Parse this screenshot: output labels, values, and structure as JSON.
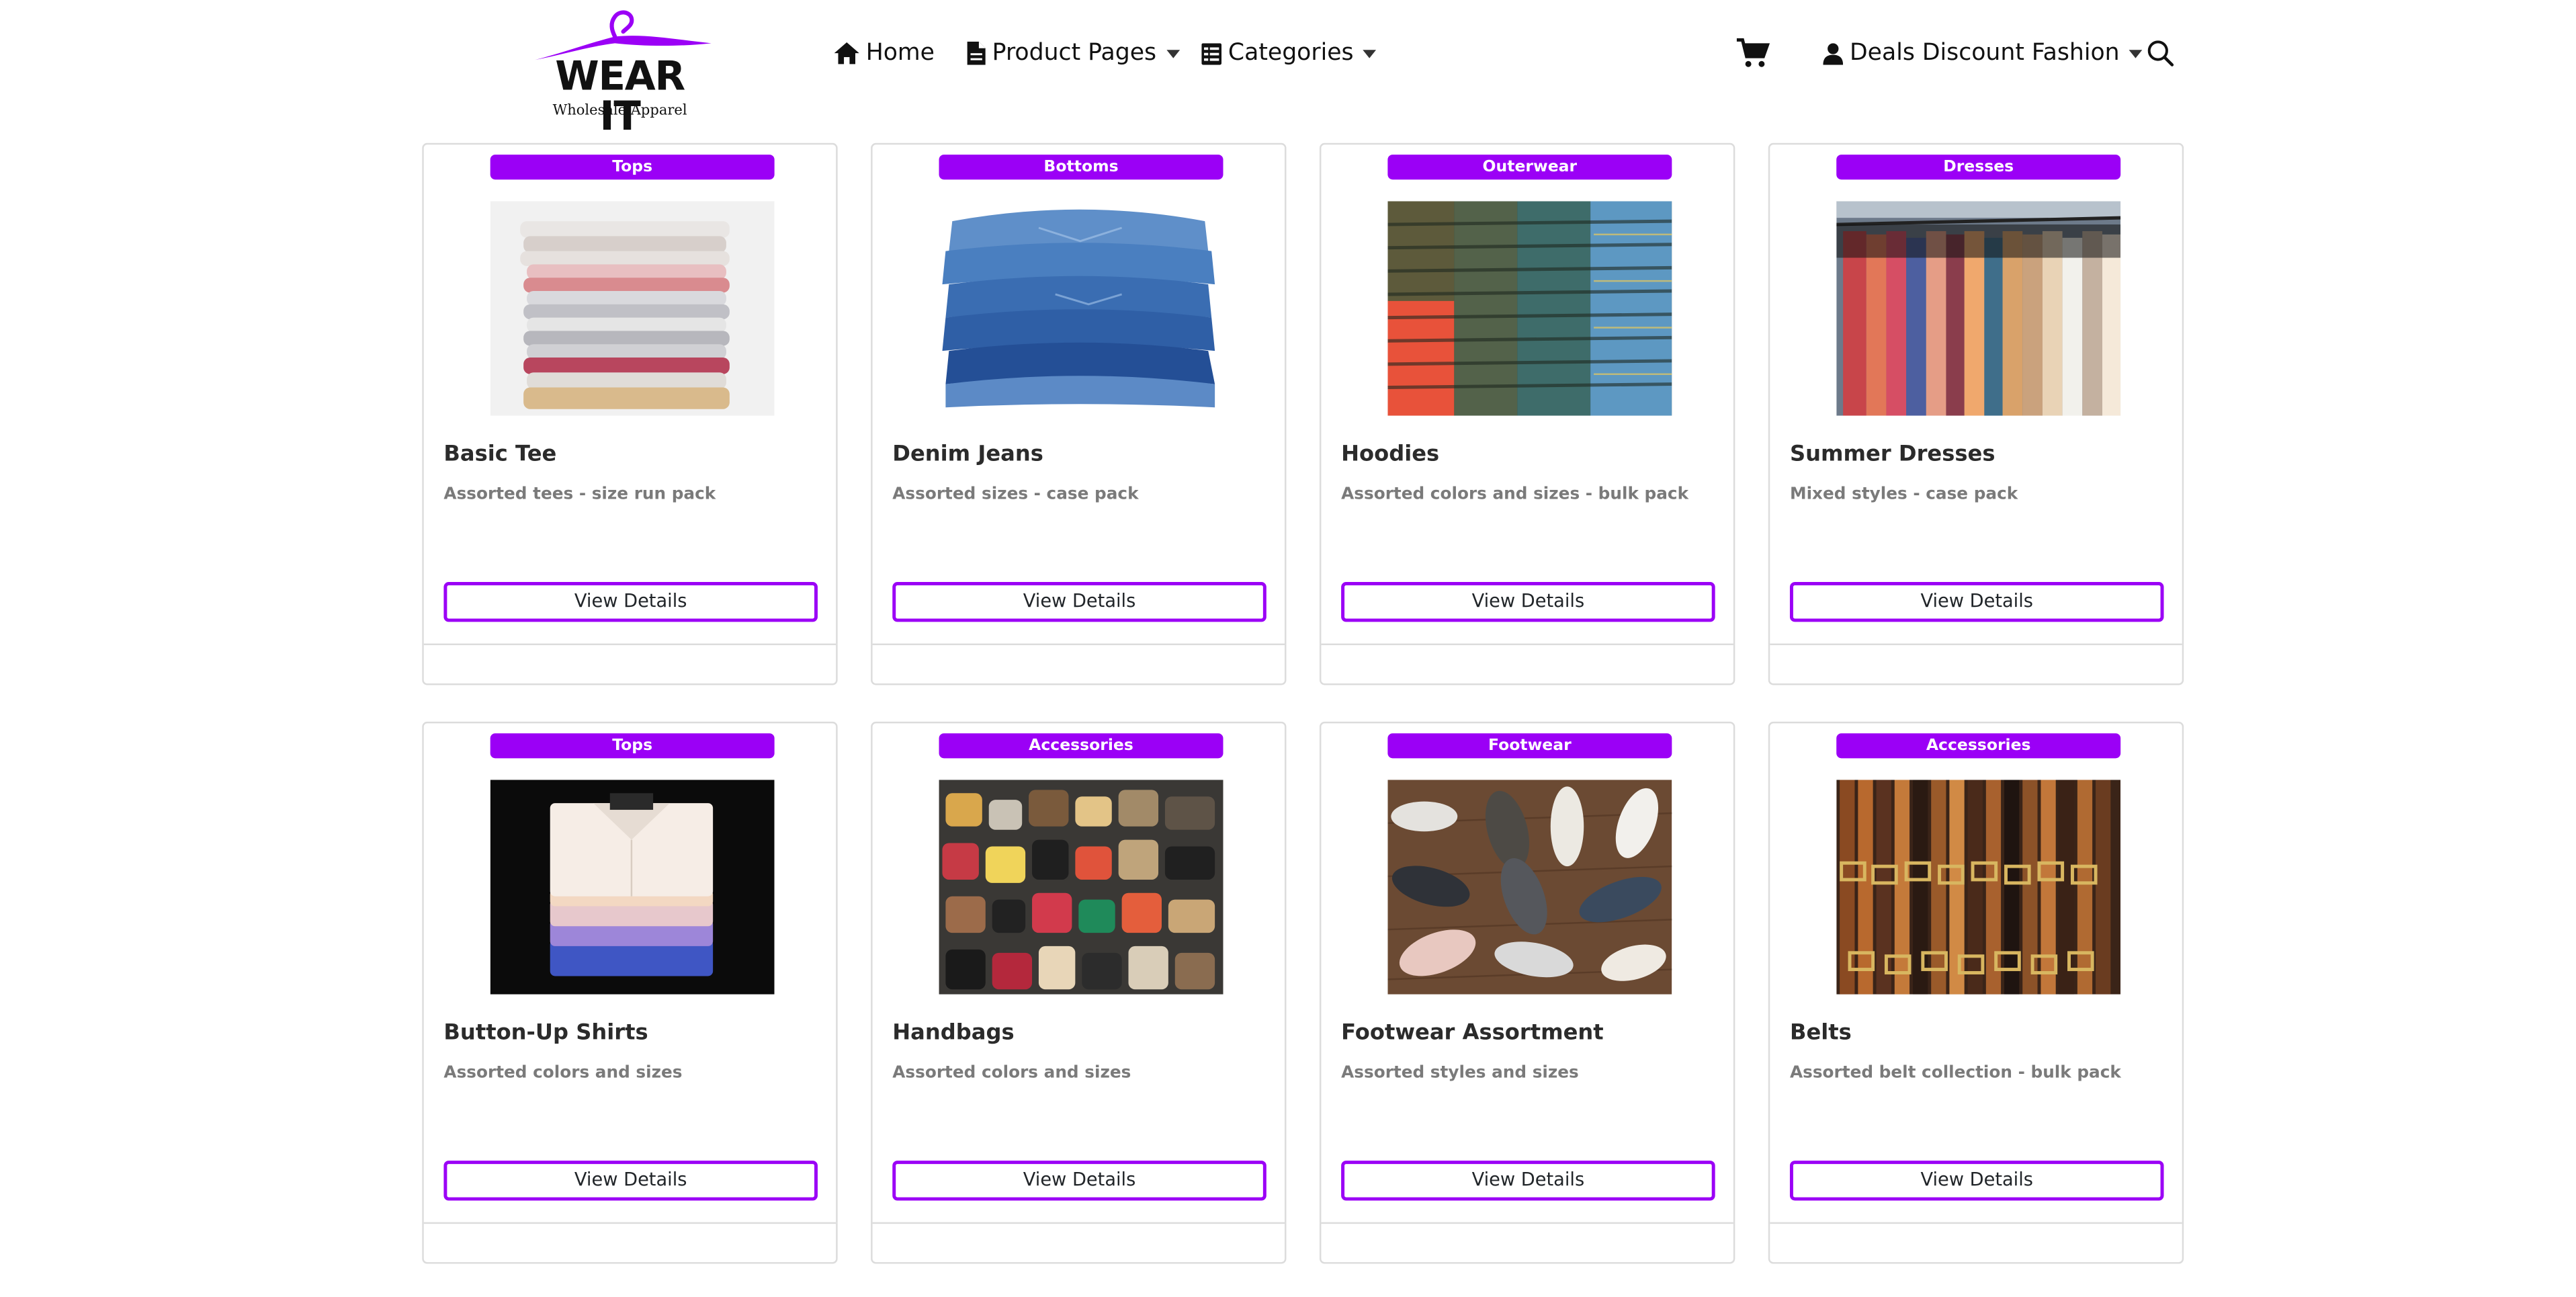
{
  "brand": {
    "name": "WEAR IT",
    "tagline": "Wholesale Apparel",
    "accent_color": "#9b00f6"
  },
  "nav": {
    "home": {
      "label": "Home",
      "icon": "home-icon"
    },
    "product_pages": {
      "label": "Product Pages",
      "icon": "document-icon"
    },
    "categories": {
      "label": "Categories",
      "icon": "list-icon"
    },
    "cart": {
      "icon": "cart-icon"
    },
    "account": {
      "label": "Deals Discount Fashion",
      "icon": "user-icon"
    },
    "search": {
      "icon": "search-icon"
    }
  },
  "products": [
    {
      "category": "Tops",
      "title": "Basic Tee",
      "description": "Assorted tees - size run pack",
      "button": "View Details",
      "image": "folded-tees-photo"
    },
    {
      "category": "Bottoms",
      "title": "Denim Jeans",
      "description": "Assorted sizes - case pack",
      "button": "View Details",
      "image": "stacked-jeans-photo"
    },
    {
      "category": "Outerwear",
      "title": "Hoodies",
      "description": "Assorted colors and sizes - bulk pack",
      "button": "View Details",
      "image": "stacked-hoodies-photo"
    },
    {
      "category": "Dresses",
      "title": "Summer Dresses",
      "description": "Mixed styles - case pack",
      "button": "View Details",
      "image": "dress-rack-photo"
    },
    {
      "category": "Tops",
      "title": "Button-Up Shirts",
      "description": "Assorted colors and sizes",
      "button": "View Details",
      "image": "folded-shirts-photo"
    },
    {
      "category": "Accessories",
      "title": "Handbags",
      "description": "Assorted colors and sizes",
      "button": "View Details",
      "image": "handbag-wall-photo"
    },
    {
      "category": "Footwear",
      "title": "Footwear Assortment",
      "description": "Assorted styles and sizes",
      "button": "View Details",
      "image": "shoes-on-floor-photo"
    },
    {
      "category": "Accessories",
      "title": "Belts",
      "description": "Assorted belt collection - bulk pack",
      "button": "View Details",
      "image": "belt-rack-photo"
    }
  ]
}
